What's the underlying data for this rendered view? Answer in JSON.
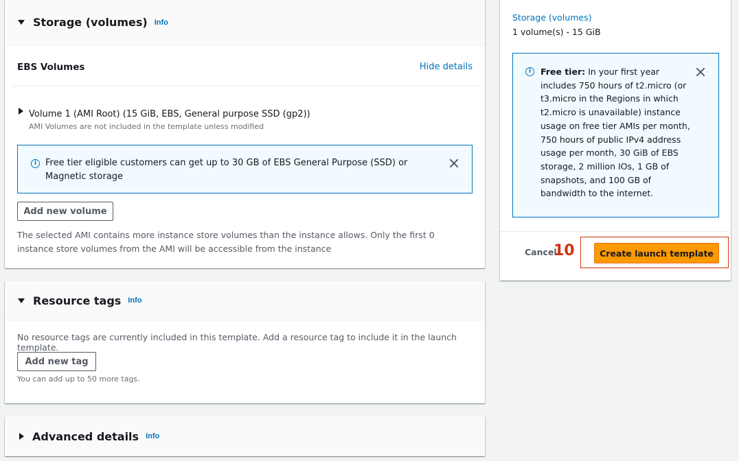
{
  "storage": {
    "title": "Storage (volumes)",
    "info": "Info",
    "ebs_title": "EBS Volumes",
    "hide_details": "Hide details",
    "volume_label": "Volume 1 (AMI Root) (15 GiB, EBS, General purpose SSD (gp2))",
    "volume_note": "AMI Volumes are not included in the template unless modified",
    "free_tier_flash": "Free tier eligible customers can get up to 30 GB of EBS General Purpose (SSD) or Magnetic storage",
    "add_volume": "Add new volume",
    "ami_note": "The selected AMI contains more instance store volumes than the instance allows. Only the first 0 instance store volumes from the AMI will be accessible from the instance"
  },
  "resource_tags": {
    "title": "Resource tags",
    "info": "Info",
    "description": "No resource tags are currently included in this template. Add a resource tag to include it in the launch template.",
    "add_tag": "Add new tag",
    "limit_note": "You can add up to 50 more tags."
  },
  "advanced": {
    "title": "Advanced details",
    "info": "Info"
  },
  "summary": {
    "storage_link": "Storage (volumes)",
    "storage_value": "1 volume(s) - 15 GiB",
    "free_tier_label": "Free tier:",
    "free_tier_text": "In your first year includes 750 hours of t2.micro (or t3.micro in the Regions in which t2.micro is unavailable) instance usage on free tier AMIs per month, 750 hours of public IPv4 address usage per month, 30 GiB of EBS storage, 2 million IOs, 1 GB of snapshots, and 100 GB of bandwidth to the internet.",
    "cancel": "Cancel",
    "step_number": "10",
    "create": "Create launch template"
  },
  "colors": {
    "link": "#0073bb",
    "primary_button": "#ff9900",
    "annotation": "#d13212",
    "flash_bg": "#f1faff"
  }
}
